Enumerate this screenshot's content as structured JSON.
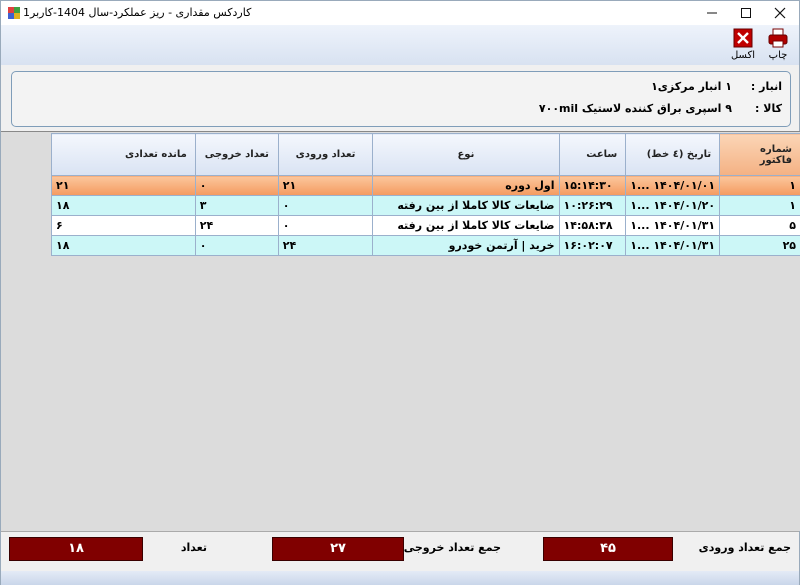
{
  "window": {
    "title": "کاردکس مقداری  - ریز عملکرد-سال 1404-کاربر1"
  },
  "toolbar": {
    "print_label": "چاپ",
    "excel_label": "اکسل"
  },
  "info": {
    "warehouse_label": "انبار :",
    "warehouse_value": "۱ انبار مرکزی۱",
    "item_label": "کالا :",
    "item_value": "۹ اسپری براق کننده لاستیک ۷۰۰mil"
  },
  "grid": {
    "columns": [
      "شماره فاکتور",
      "تاریخ (٤ خط)",
      "ساعت",
      "نوع",
      "تعداد ورودی",
      "تعداد خروجی",
      "مانده تعدادی"
    ],
    "rows": [
      [
        "۱",
        "۱۴۰۴/۰۱/۰۱ ...۱",
        "۱۵:۱۴:۳۰",
        "اول دوره",
        "۲۱",
        "۰",
        "۲۱"
      ],
      [
        "۱",
        "۱۴۰۴/۰۱/۲۰ ...۱",
        "۱۰:۲۶:۲۹",
        "ضایعات  کالا کاملا از بین رفته",
        "۰",
        "۳",
        "۱۸"
      ],
      [
        "۵",
        "۱۴۰۴/۰۱/۳۱ ...۱",
        "۱۴:۵۸:۳۸",
        "ضایعات  کالا کاملا از بین رفته",
        "۰",
        "۲۴",
        "۶"
      ],
      [
        "۲۵",
        "۱۴۰۴/۰۱/۳۱ ...۱",
        "۱۶:۰۲:۰۷",
        "خرید  |  آرتمن خودرو",
        "۲۴",
        "۰",
        "۱۸"
      ]
    ]
  },
  "footer": {
    "total_in_label": "جمع تعداد ورودی",
    "total_in_value": "۴۵",
    "total_out_label": "جمع تعداد خروجی",
    "total_out_value": "۲۷",
    "count_label": "تعداد",
    "count_value": "۱۸"
  },
  "colors": {
    "total_box_bg": "#800000",
    "selected_row": "#f4a46a",
    "alt_row": "#ccf7f7"
  }
}
